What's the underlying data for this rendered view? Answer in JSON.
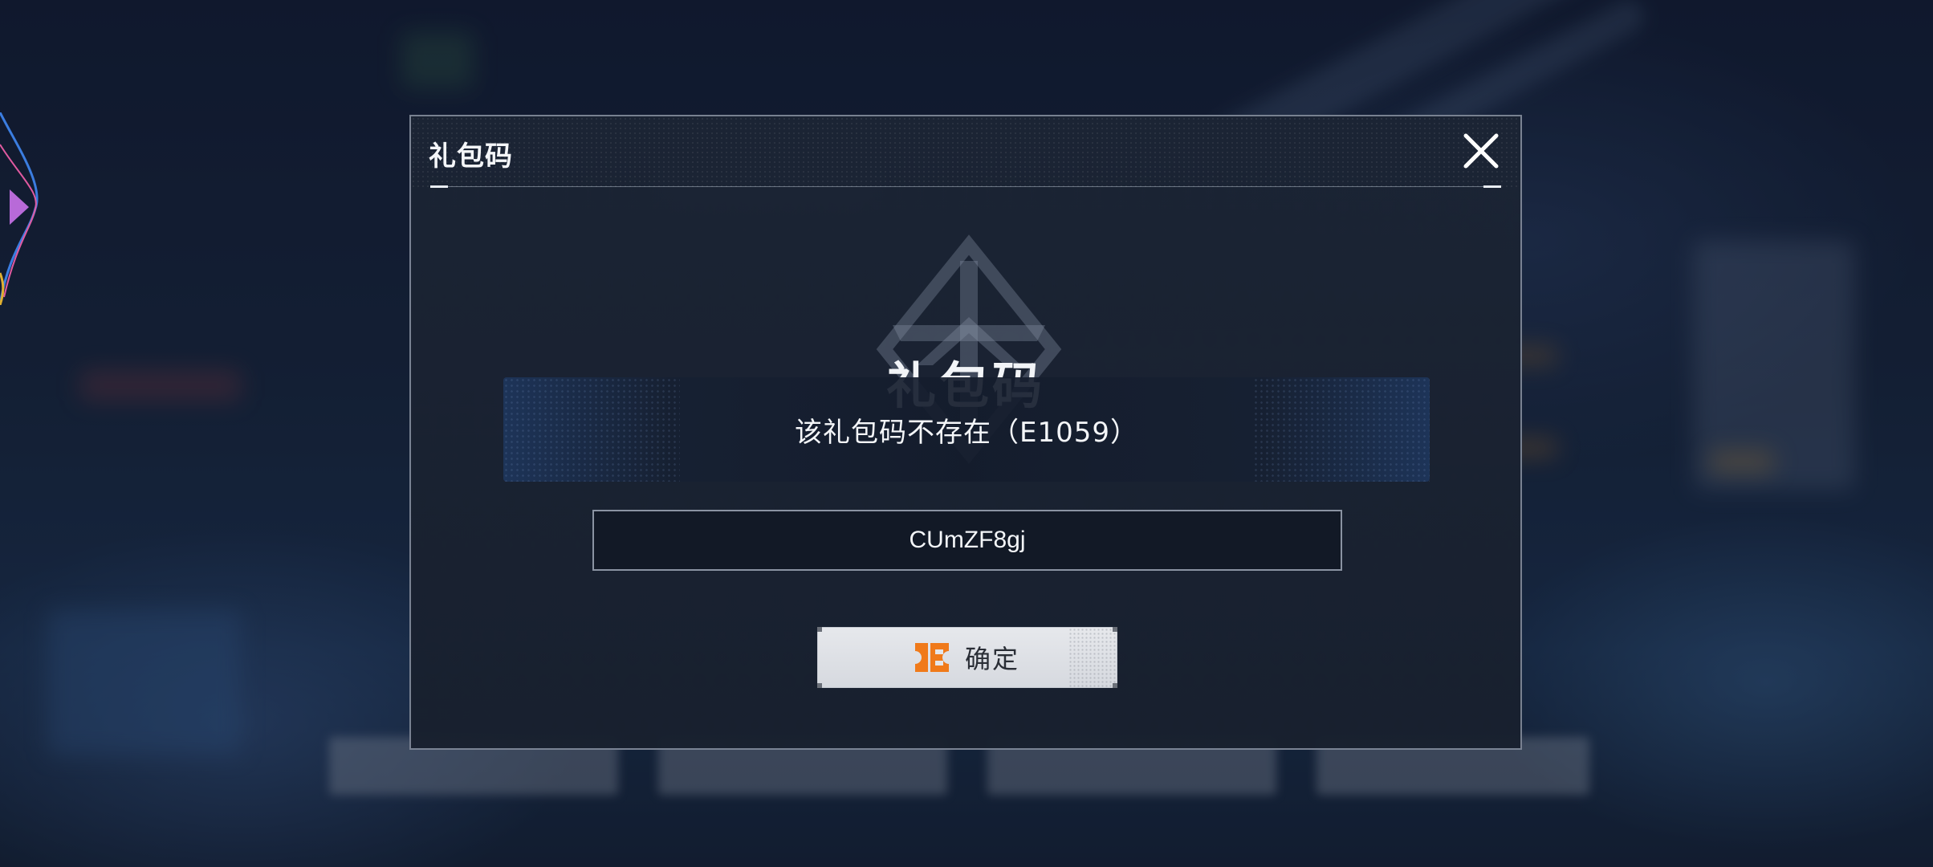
{
  "dialog": {
    "title": "礼包码",
    "close_icon": "close-icon",
    "emblem_text": "礼包码",
    "error_message": "该礼包码不存在（E1059）",
    "code_input_value": "CUmZF8gj",
    "confirm_label": "确定",
    "confirm_icon": "orange-ticket-icon",
    "accent_color": "#f07a1a"
  }
}
